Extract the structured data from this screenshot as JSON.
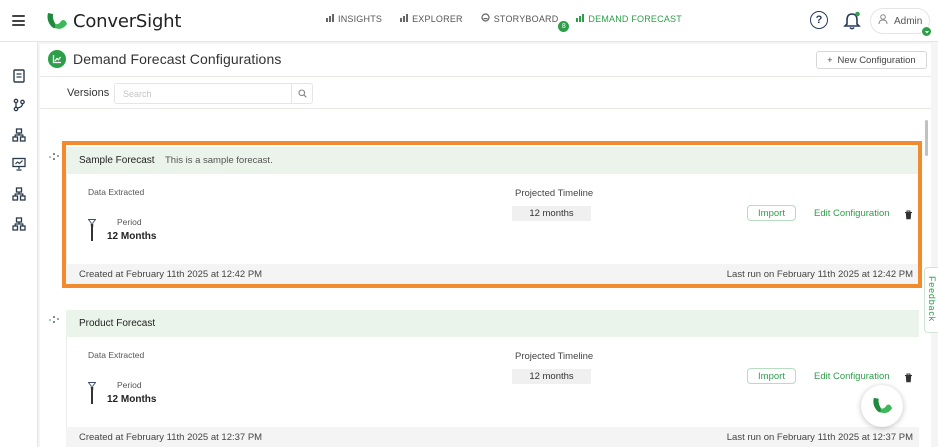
{
  "app": {
    "name": "ConverSight"
  },
  "nav": [
    {
      "label": "INSIGHTS",
      "icon": "bar-chart-icon",
      "active": false
    },
    {
      "label": "EXPLORER",
      "icon": "bar-chart-icon",
      "active": false
    },
    {
      "label": "STORYBOARD",
      "icon": "storyboard-icon",
      "active": false,
      "badge": "8"
    },
    {
      "label": "DEMAND FORECAST",
      "icon": "bar-chart-icon",
      "active": true
    }
  ],
  "user": {
    "label": "Admin"
  },
  "sidebar": {
    "items": [
      "report-icon",
      "branch-icon",
      "hierarchy-icon",
      "presentation-icon",
      "hierarchy-icon",
      "hierarchy-icon"
    ]
  },
  "page": {
    "title": "Demand Forecast Configurations",
    "new_button": "New Configuration"
  },
  "versions": {
    "label": "Versions",
    "search_placeholder": "Search"
  },
  "cards": [
    {
      "name": "Sample Forecast",
      "description": "This is a sample forecast.",
      "data_label": "Data Extracted",
      "period_label": "Period",
      "period_value": "12 Months",
      "projected_label": "Projected Timeline",
      "projected_value": "12 months",
      "import_label": "Import",
      "edit_label": "Edit Configuration",
      "created": "Created at February 11th 2025 at 12:42 PM",
      "last_run": "Last run on February 11th 2025 at 12:42 PM"
    },
    {
      "name": "Product Forecast",
      "description": "",
      "data_label": "Data Extracted",
      "period_label": "Period",
      "period_value": "12 Months",
      "projected_label": "Projected Timeline",
      "projected_value": "12 months",
      "import_label": "Import",
      "edit_label": "Edit Configuration",
      "created": "Created at February 11th 2025 at 12:37 PM",
      "last_run": "Last run on February 11th 2025 at 12:37 PM"
    }
  ],
  "feedback": {
    "label": "Feedback"
  },
  "colors": {
    "accent": "#2e9e4a",
    "highlight": "#f28a2e",
    "card_header": "#eaf4ea"
  }
}
